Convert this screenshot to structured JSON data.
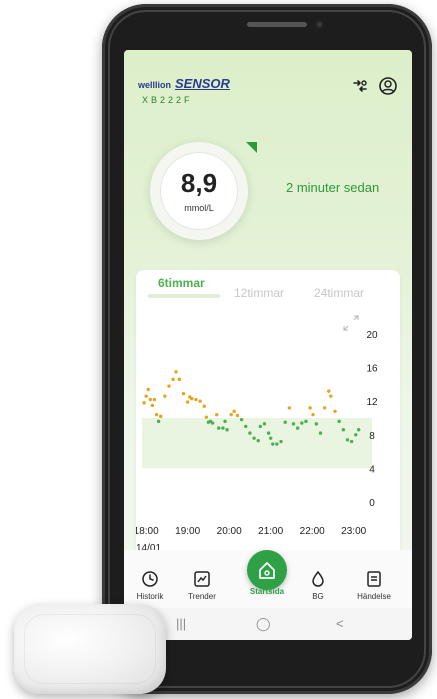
{
  "app": {
    "brand_logo": "welllion",
    "brand_name": "SENSOR",
    "serial": "XB222F"
  },
  "reading": {
    "value": "8,9",
    "unit": "mmol/L",
    "since": "2 minuter sedan"
  },
  "tabs": [
    {
      "label": "6timmar",
      "active": true
    },
    {
      "label": "12timmar",
      "active": false
    },
    {
      "label": "24timmar",
      "active": false
    }
  ],
  "chart_data": {
    "type": "scatter",
    "x_tick_labels": [
      "18:00",
      "19:00",
      "20:00",
      "21:00",
      "22:00",
      "23:00"
    ],
    "y_tick_labels": [
      "20",
      "16",
      "12",
      "8",
      "4",
      "0"
    ],
    "xlim": [
      17.9,
      23.2
    ],
    "ylim": [
      0,
      20
    ],
    "target_range": [
      4,
      10
    ],
    "date_label": "14/01",
    "colors": {
      "in_range": "#4caf50",
      "high": "#e3a521",
      "band": "#e9f5e1"
    },
    "points": [
      [
        17.95,
        11.8
      ],
      [
        18.0,
        12.6
      ],
      [
        18.05,
        13.4
      ],
      [
        18.1,
        12.2
      ],
      [
        18.15,
        11.5
      ],
      [
        18.2,
        12.2
      ],
      [
        18.25,
        10.4
      ],
      [
        18.3,
        9.6
      ],
      [
        18.35,
        10.2
      ],
      [
        18.45,
        12.6
      ],
      [
        18.55,
        13.8
      ],
      [
        18.65,
        14.6
      ],
      [
        18.72,
        15.5
      ],
      [
        18.8,
        14.6
      ],
      [
        18.9,
        12.9
      ],
      [
        19.0,
        11.9
      ],
      [
        19.05,
        12.5
      ],
      [
        19.1,
        12.3
      ],
      [
        19.2,
        12.2
      ],
      [
        19.3,
        12.0
      ],
      [
        19.4,
        11.4
      ],
      [
        19.45,
        10.1
      ],
      [
        19.5,
        9.5
      ],
      [
        19.55,
        9.6
      ],
      [
        19.6,
        9.4
      ],
      [
        19.7,
        10.4
      ],
      [
        19.75,
        8.8
      ],
      [
        19.85,
        8.8
      ],
      [
        19.9,
        9.6
      ],
      [
        19.95,
        8.6
      ],
      [
        20.05,
        10.4
      ],
      [
        20.12,
        10.8
      ],
      [
        20.2,
        10.3
      ],
      [
        20.3,
        9.8
      ],
      [
        20.4,
        9.0
      ],
      [
        20.5,
        8.2
      ],
      [
        20.6,
        7.6
      ],
      [
        20.7,
        7.3
      ],
      [
        20.75,
        9.0
      ],
      [
        20.85,
        9.3
      ],
      [
        20.95,
        8.2
      ],
      [
        21.0,
        7.6
      ],
      [
        21.05,
        6.9
      ],
      [
        21.15,
        6.9
      ],
      [
        21.25,
        7.2
      ],
      [
        21.35,
        9.5
      ],
      [
        21.45,
        11.2
      ],
      [
        21.55,
        9.3
      ],
      [
        21.65,
        8.8
      ],
      [
        21.75,
        9.4
      ],
      [
        21.85,
        9.6
      ],
      [
        21.95,
        11.2
      ],
      [
        22.02,
        10.4
      ],
      [
        22.1,
        9.3
      ],
      [
        22.2,
        8.2
      ],
      [
        22.3,
        11.2
      ],
      [
        22.4,
        13.2
      ],
      [
        22.45,
        12.6
      ],
      [
        22.55,
        10.8
      ],
      [
        22.65,
        9.6
      ],
      [
        22.75,
        8.6
      ],
      [
        22.85,
        7.4
      ],
      [
        22.95,
        7.2
      ],
      [
        23.05,
        8.0
      ],
      [
        23.12,
        8.6
      ]
    ]
  },
  "nav": {
    "items": [
      {
        "label": "Historik"
      },
      {
        "label": "Trender"
      },
      {
        "label": "Startsida"
      },
      {
        "label": "BG"
      },
      {
        "label": "Händelse"
      }
    ]
  },
  "system_nav": {
    "recents": "|||",
    "home": "◯",
    "back": "<"
  }
}
